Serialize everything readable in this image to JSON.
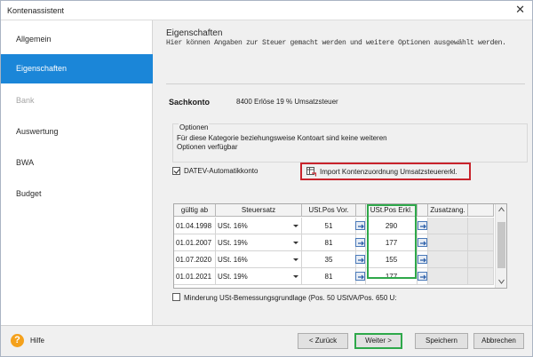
{
  "window": {
    "title": "Kontenassistent",
    "close_glyph": "✕"
  },
  "sidebar": {
    "items": [
      {
        "label": "Allgemein",
        "state": "normal"
      },
      {
        "label": "Eigenschaften",
        "state": "active"
      },
      {
        "label": "Bank",
        "state": "disabled"
      },
      {
        "label": "Auswertung",
        "state": "normal"
      },
      {
        "label": "BWA",
        "state": "normal"
      },
      {
        "label": "Budget",
        "state": "normal"
      }
    ]
  },
  "main": {
    "title": "Eigenschaften",
    "description": "Hier können Angaben zur Steuer gemacht werden und weitere Optionen ausgewählt werden.",
    "sachkonto_label": "Sachkonto",
    "sachkonto_value": "8400 Erlöse 19 % Umsatzsteuer",
    "optionen": {
      "legend": "Optionen",
      "line1": "Für diese Kategorie beziehungsweise Kontoart sind keine weiteren",
      "line2": "Optionen verfügbar"
    },
    "datev_checkbox": {
      "label": "DATEV-Automatikkonto",
      "checked": true
    },
    "import_button": {
      "label": "Import Kontenzuordnung Umsatzsteuererkl.",
      "icon": "import-table-icon"
    },
    "table": {
      "headers": [
        "gültig ab",
        "Steuersatz",
        "USt.Pos Vor.",
        "USt.Pos Erkl.",
        "Zusatzang."
      ],
      "rows": [
        {
          "date": "01.04.1998",
          "rate": "USt. 16%",
          "pos_vor": "51",
          "pos_erkl": "290"
        },
        {
          "date": "01.01.2007",
          "rate": "USt. 19%",
          "pos_vor": "81",
          "pos_erkl": "177"
        },
        {
          "date": "01.07.2020",
          "rate": "USt. 16%",
          "pos_vor": "35",
          "pos_erkl": "155"
        },
        {
          "date": "01.01.2021",
          "rate": "USt. 19%",
          "pos_vor": "81",
          "pos_erkl": "177"
        }
      ]
    },
    "minderung_checkbox": {
      "label": "Minderung USt-Bemessungsgrundlage (Pos. 50 UStVA/Pos. 650 U:",
      "checked": false
    }
  },
  "footer": {
    "help_glyph": "?",
    "help_label": "Hilfe",
    "back_label": "< Zurück",
    "next_label": "Weiter >",
    "save_label": "Speichern",
    "cancel_label": "Abbrechen"
  },
  "colors": {
    "accent": "#1b86d8",
    "highlight_red": "#c8232c",
    "highlight_green": "#2ea84a",
    "help": "#f4a11c"
  }
}
